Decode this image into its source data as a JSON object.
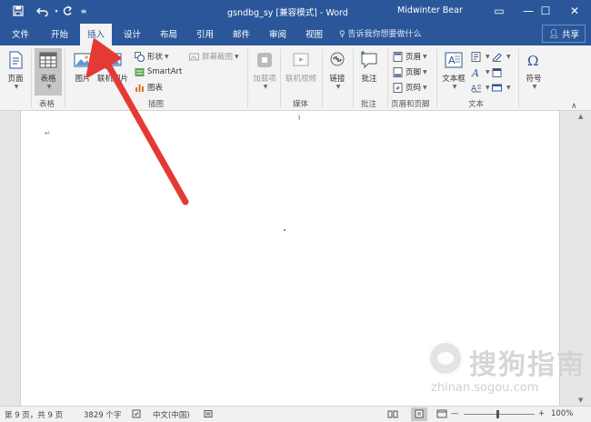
{
  "window": {
    "title": "gsndbg_sy [兼容模式] - Word",
    "user": "Midwinter Bear",
    "minimize_glyph": "—",
    "restore_glyph": "☐",
    "close_glyph": "✕",
    "ribbon_display_glyph": "▭"
  },
  "quick_access": {
    "save_icon": "save-icon",
    "undo_icon": "undo-icon",
    "redo_icon": "redo-icon",
    "customize_icon": "customize-icon"
  },
  "tabs": [
    {
      "label": "文件"
    },
    {
      "label": "开始"
    },
    {
      "label": "插入",
      "active": true
    },
    {
      "label": "设计"
    },
    {
      "label": "布局"
    },
    {
      "label": "引用"
    },
    {
      "label": "邮件"
    },
    {
      "label": "审阅"
    },
    {
      "label": "视图"
    }
  ],
  "tell_me": {
    "placeholder": "告诉我你想要做什么"
  },
  "share": {
    "label": "共享"
  },
  "ribbon": {
    "groups": [
      {
        "label": "表格"
      },
      {
        "label": "插图"
      },
      {
        "label": "媒体"
      },
      {
        "label": "批注"
      },
      {
        "label": "页眉和页脚"
      },
      {
        "label": "文本"
      }
    ],
    "buttons": {
      "pages": "页面",
      "table": "表格",
      "pictures": "图片",
      "online_pictures": "联机图片",
      "shapes": "形状",
      "smartart": "SmartArt",
      "chart": "图表",
      "screenshot": "屏幕截图",
      "addins": "加载项",
      "online_video": "联机视频",
      "links": "链接",
      "comment": "批注",
      "header": "页眉",
      "footer": "页脚",
      "page_number": "页码",
      "textbox": "文本框",
      "symbols": "符号"
    },
    "collapse_glyph": "∧"
  },
  "document": {
    "paragraph_mark": "↵",
    "cursor_mark": "Ɨ"
  },
  "status": {
    "page": "第 9 页，共 9 页",
    "words": "3829 个字",
    "language": "中文(中国)",
    "zoom": "100%",
    "zoom_minus": "—",
    "zoom_plus": "+"
  },
  "watermark": {
    "brand": "搜狗指南",
    "url": "zhinan.sogou.com"
  },
  "colors": {
    "accent": "#2b579a",
    "ribbon_bg": "#f3f3f3",
    "arrow": "#e53935"
  }
}
